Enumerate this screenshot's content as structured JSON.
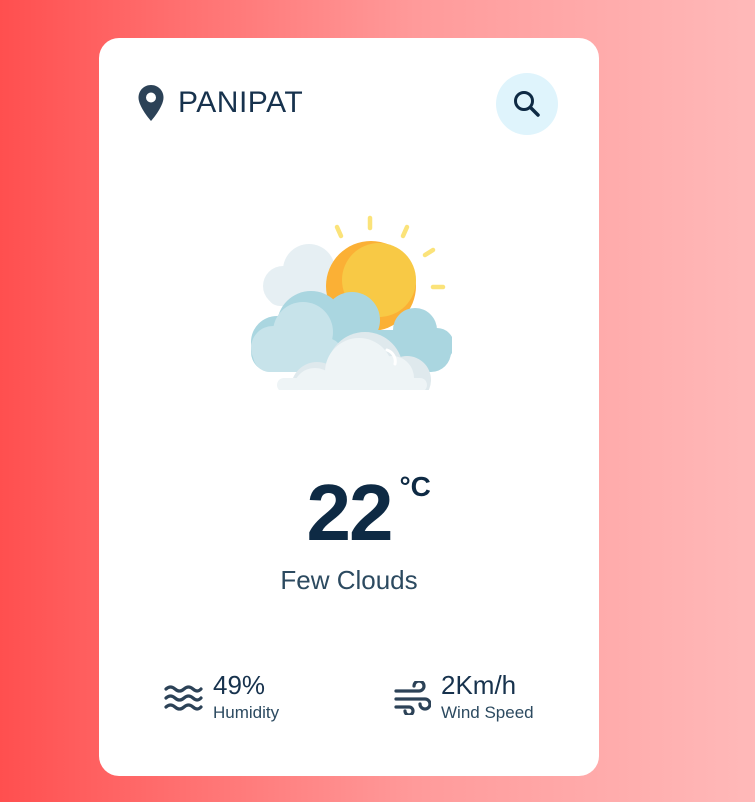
{
  "location": {
    "city": "PANIPAT",
    "icon": "map-pin-icon"
  },
  "search": {
    "icon": "search-icon"
  },
  "weather": {
    "icon": "partly-cloudy-sun-icon",
    "temperature": "22",
    "unit": "°C",
    "description": "Few Clouds"
  },
  "stats": {
    "humidity": {
      "value": "49%",
      "label": "Humidity",
      "icon": "humidity-waves-icon"
    },
    "wind": {
      "value": "2Km/h",
      "label": "Wind Speed",
      "icon": "wind-icon"
    }
  },
  "colors": {
    "bg_left": "#ff4f4f",
    "bg_right": "#ffb9b9",
    "card": "#ffffff",
    "text_dark": "#0e2a44",
    "search_bg": "#dff4fc",
    "sun": "#fbb035"
  }
}
